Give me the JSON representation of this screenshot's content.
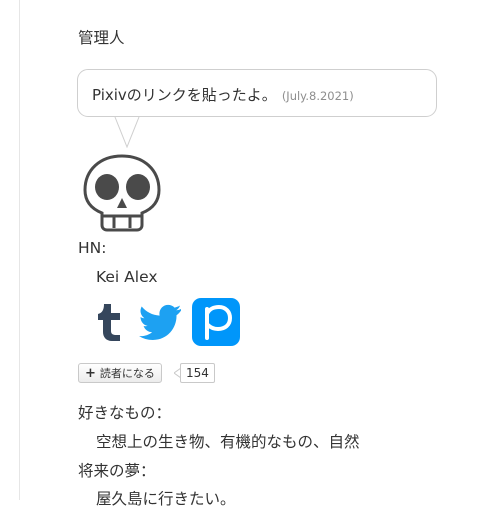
{
  "section": {
    "heading": "管理人"
  },
  "bubble": {
    "message": "Pixivのリンクを貼ったよ。",
    "date": "(July.8.2021)"
  },
  "avatar": {
    "icon": "skull-icon"
  },
  "profile": {
    "hn_label": "HN:",
    "hn_value": "Kei Alex"
  },
  "social": [
    {
      "name": "tumblr",
      "icon": "tumblr-icon",
      "glyph": "t",
      "color": "#35465c"
    },
    {
      "name": "twitter",
      "icon": "twitter-icon",
      "color": "#1da1f2"
    },
    {
      "name": "pixiv",
      "icon": "pixiv-icon",
      "glyph": "p",
      "color": "#0096fa"
    }
  ],
  "reader": {
    "button_label": "読者になる",
    "count": "154"
  },
  "likes": {
    "label": "好きなもの：",
    "value": "空想上の生き物、有機的なもの、自然"
  },
  "dream": {
    "label": "将来の夢：",
    "value": "屋久島に行きたい。"
  }
}
